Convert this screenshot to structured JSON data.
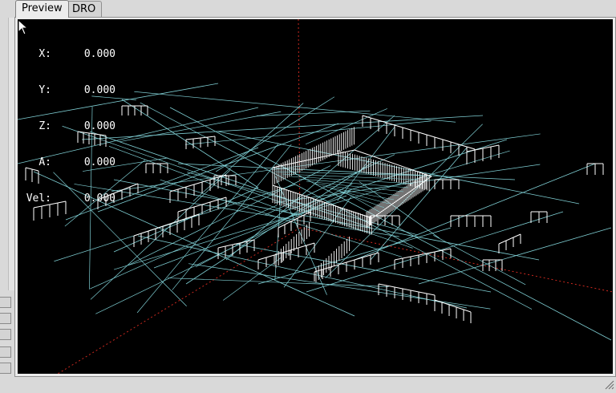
{
  "tabs": [
    {
      "label": "Preview",
      "active": true
    },
    {
      "label": "DRO",
      "active": false
    }
  ],
  "dro": [
    {
      "label": "X:",
      "value": "0.000"
    },
    {
      "label": "Y:",
      "value": "0.000"
    },
    {
      "label": "Z:",
      "value": "0.000"
    },
    {
      "label": "A:",
      "value": "0.000"
    },
    {
      "label": "Vel:",
      "value": "0.000"
    }
  ],
  "colors": {
    "viewport_bg": "#000000",
    "toolpath_traverse": "#7fcfd4",
    "toolpath_feed": "#ffffff",
    "axis_z": "#c8281e",
    "axis_x": "#c8281e"
  },
  "icons": {
    "cursor": "mouse-pointer-icon",
    "resize": "resize-grip-icon"
  }
}
